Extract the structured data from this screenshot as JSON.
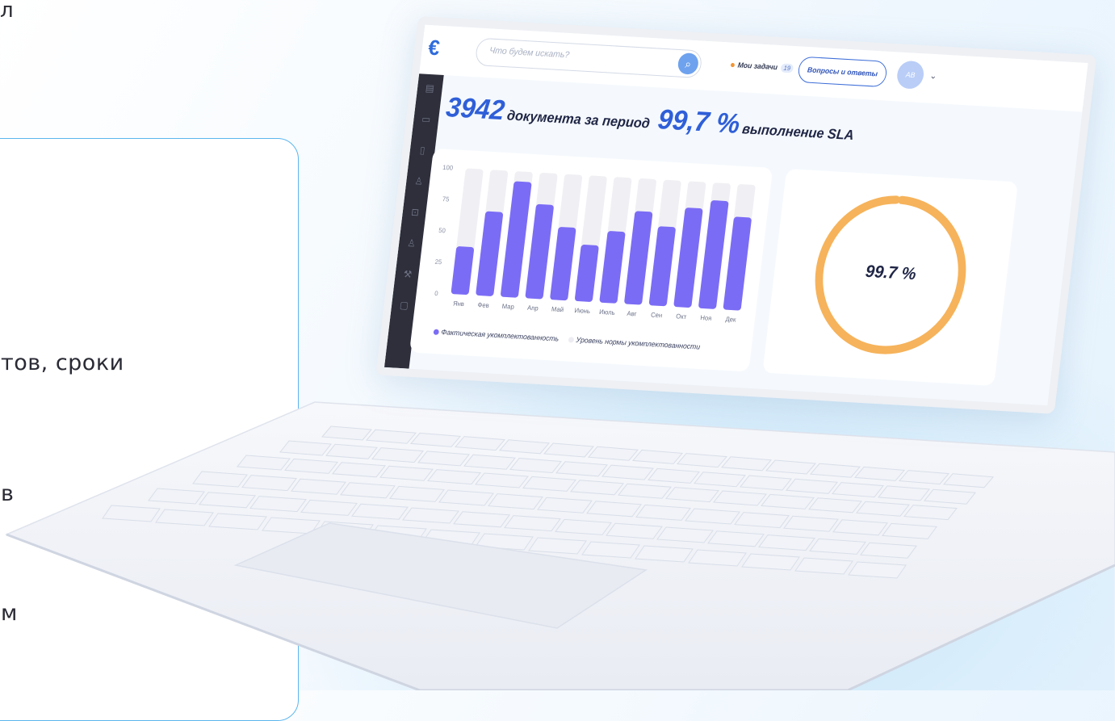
{
  "background_partial": {
    "top_char": "л",
    "lines": [
      "тов, сроки",
      "в",
      "м"
    ]
  },
  "app": {
    "search": {
      "placeholder": "Что будем искать?"
    },
    "tasks": {
      "label": "Мои задачи",
      "count": "19"
    },
    "faq_button": "Вопросы и ответы",
    "avatar": "АВ",
    "headline": {
      "docs_count": "3942",
      "docs_label": "документа за период",
      "sla_value": "99,7 %",
      "sla_label": "выполнение SLA"
    },
    "donut_label": "99.7 %"
  },
  "chart_data": [
    {
      "type": "bar",
      "categories": [
        "Янв",
        "Фев",
        "Мар",
        "Апр",
        "Май",
        "Июнь",
        "Июль",
        "Авг",
        "Сен",
        "Окт",
        "Ноя",
        "Дек"
      ],
      "series": [
        {
          "name": "Фактическая укомплектованность",
          "values": [
            38,
            67,
            92,
            75,
            58,
            45,
            57,
            74,
            63,
            79,
            86,
            74
          ],
          "color": "#7b6cf6"
        },
        {
          "name": "Уровень нормы укомплектованности",
          "values": [
            100,
            100,
            100,
            100,
            100,
            100,
            100,
            100,
            100,
            100,
            100,
            100
          ],
          "color": "#f0f0f4"
        }
      ],
      "yticks": [
        "0",
        "25",
        "50",
        "75",
        "100"
      ],
      "ylim": [
        0,
        100
      ],
      "legend": "bottom-left"
    },
    {
      "type": "pie",
      "values": [
        99.7,
        0.3
      ],
      "label": "99.7 %",
      "color": "#f6b35b"
    }
  ]
}
